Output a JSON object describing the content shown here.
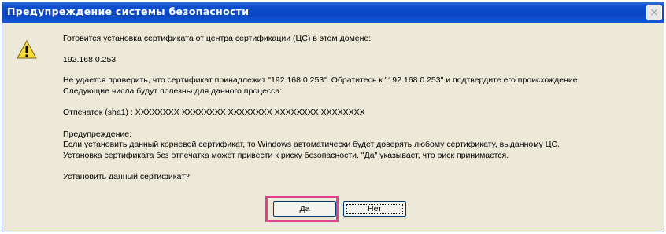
{
  "window": {
    "title": "Предупреждение системы безопасности",
    "close_glyph": "×"
  },
  "icon": "warning-icon",
  "body": {
    "intro": "Готовится установка сертификата от центра сертификации (ЦС) в этом домене:",
    "host": "192.168.0.253",
    "cannot_verify": "Не удается проверить, что сертификат принадлежит \"192.168.0.253\". Обратитесь к \"192.168.0.253\" и подтвердите его происхождение.",
    "numbers_hint": "Следующие числа будут полезны для данного процесса:",
    "thumbprint": "Отпечаток (sha1) : XXXXXXXX XXXXXXXX XXXXXXXX XXXXXXXX XXXXXXXX",
    "warning_heading": "Предупреждение:",
    "warning_line1": "Если установить данный корневой сертификат, то Windows автоматически будет доверять любому сертификату, выданному ЦС.",
    "warning_line2": "Установка сертификата без отпечатка может привести к риску безопасности. \"Да\" указывает, что риск принимается.",
    "question": "Установить данный сертификат?"
  },
  "buttons": {
    "yes": "Да",
    "no": "Нет"
  },
  "colors": {
    "titlebar": "#0b45c3",
    "dialog_bg": "#ece9d8",
    "highlight": "#e0408c"
  }
}
